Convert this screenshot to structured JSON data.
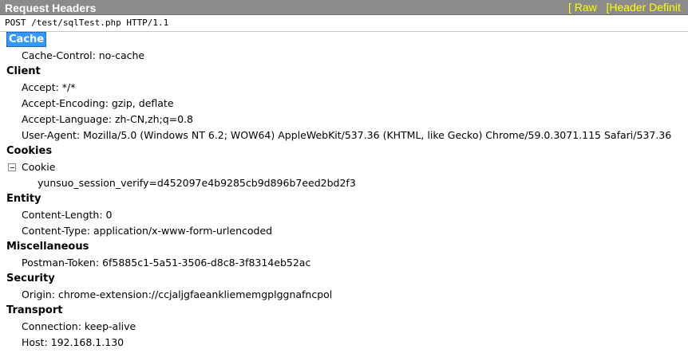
{
  "header": {
    "title": "Request Headers",
    "link_raw": "[ Raw",
    "link_definitions": "[Header Definit"
  },
  "request_line": "POST /test/sqlTest.php HTTP/1.1",
  "groups": {
    "cache": {
      "label": "Cache",
      "items": [
        {
          "text": "Cache-Control: no-cache"
        }
      ]
    },
    "client": {
      "label": "Client",
      "items": [
        {
          "text": "Accept: */*"
        },
        {
          "text": "Accept-Encoding: gzip, deflate"
        },
        {
          "text": "Accept-Language: zh-CN,zh;q=0.8"
        },
        {
          "text": "User-Agent: Mozilla/5.0 (Windows NT 6.2; WOW64) AppleWebKit/537.36 (KHTML, like Gecko) Chrome/59.0.3071.115 Safari/537.36"
        }
      ]
    },
    "cookies": {
      "label": "Cookies",
      "cookie_node": "Cookie",
      "cookie_value": "yunsuo_session_verify=d452097e4b9285cb9d896b7eed2bd2f3"
    },
    "entity": {
      "label": "Entity",
      "items": [
        {
          "text": "Content-Length: 0"
        },
        {
          "text": "Content-Type: application/x-www-form-urlencoded"
        }
      ]
    },
    "misc": {
      "label": "Miscellaneous",
      "items": [
        {
          "text": "Postman-Token: 6f5885c1-5a51-3506-d8c8-3f8314eb52ac"
        }
      ]
    },
    "security": {
      "label": "Security",
      "items": [
        {
          "text": "Origin: chrome-extension://ccjaljgfaeankliememgplggnafncpol"
        }
      ]
    },
    "transport": {
      "label": "Transport",
      "items": [
        {
          "text": "Connection: keep-alive"
        },
        {
          "text": "Host: 192.168.1.130"
        }
      ]
    }
  },
  "colors": {
    "header_bg": "#8b8b8b",
    "header_title": "#ffffff",
    "header_links": "#ffff00",
    "selection_bg": "#3399ff"
  }
}
